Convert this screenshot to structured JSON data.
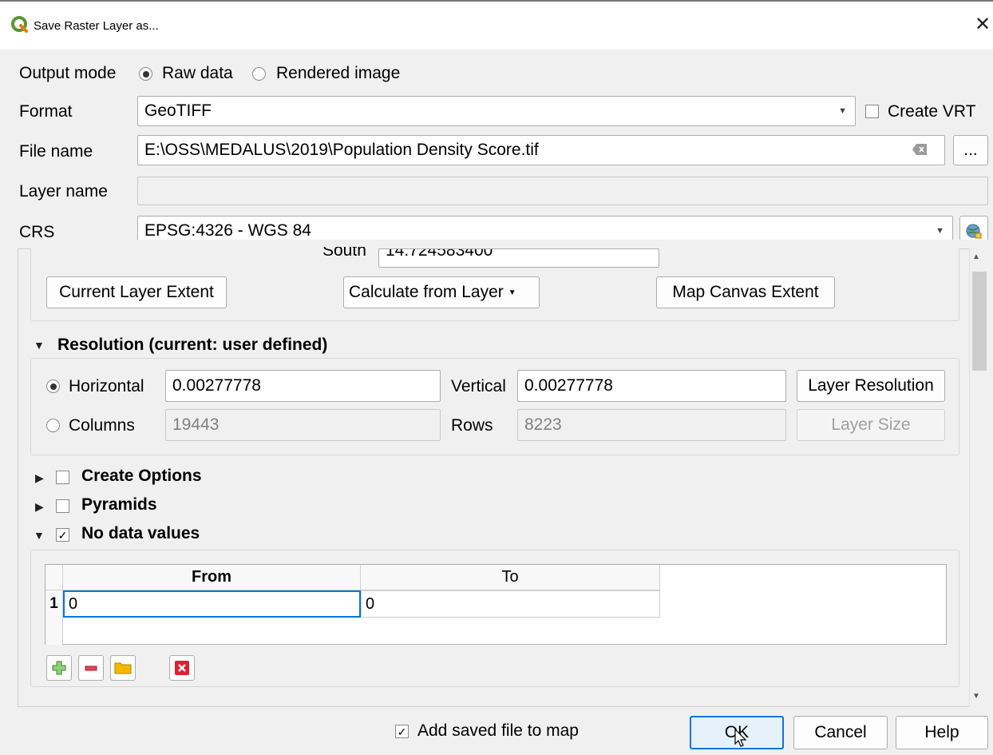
{
  "window": {
    "title": "Save Raster Layer as...",
    "close_glyph": "✕"
  },
  "output_mode": {
    "label": "Output mode",
    "raw": "Raw data",
    "rendered": "Rendered image",
    "selected": "raw"
  },
  "format": {
    "label": "Format",
    "value": "GeoTIFF",
    "create_vrt": "Create VRT"
  },
  "file": {
    "label": "File name",
    "value": "E:\\OSS\\MEDALUS\\2019\\Population Density Score.tif",
    "browse": "..."
  },
  "layer": {
    "label": "Layer name",
    "value": ""
  },
  "crs": {
    "label": "CRS",
    "value": "EPSG:4326 - WGS 84"
  },
  "extent": {
    "south_label": "South",
    "south_value": "14.724583400",
    "current_layer": "Current Layer Extent",
    "calc_layer": "Calculate from Layer",
    "map_canvas": "Map Canvas Extent"
  },
  "resolution": {
    "title": "Resolution (current: user defined)",
    "horizontal_label": "Horizontal",
    "horizontal_value": "0.00277778",
    "vertical_label": "Vertical",
    "vertical_value": "0.00277778",
    "layer_resolution": "Layer Resolution",
    "columns_label": "Columns",
    "columns_value": "19443",
    "rows_label": "Rows",
    "rows_value": "8223",
    "layer_size": "Layer Size"
  },
  "sections": {
    "create_options": "Create Options",
    "pyramids": "Pyramids",
    "nodata": "No data values"
  },
  "nodata_table": {
    "headers": [
      "From",
      "To"
    ],
    "rows": [
      {
        "index": "1",
        "from": "0",
        "to": "0"
      }
    ]
  },
  "footer": {
    "add_to_map": "Add saved file to map",
    "ok": "OK",
    "cancel": "Cancel",
    "help": "Help"
  }
}
